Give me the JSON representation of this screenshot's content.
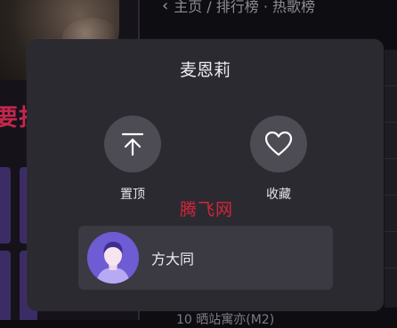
{
  "background": {
    "header_breadcrumb": "主页 / 排行榜 · 热歌榜",
    "left_banner_text": "要担",
    "bottom_list_text": "10  晒站寓亦(M2)"
  },
  "sheet": {
    "title": "麦恩莉",
    "actions": [
      {
        "label": "置顶",
        "icon": "pin-to-top-icon"
      },
      {
        "label": "收藏",
        "icon": "heart-outline-icon"
      }
    ],
    "singer": {
      "name": "方大同",
      "avatar_color": "#6d5cd3"
    }
  },
  "watermark": "腾飞网",
  "colors": {
    "sheet_bg": "#2b2a31",
    "action_circle": "#4d4c54",
    "singer_card_bg": "#3b3a42",
    "watermark": "#d3263a"
  }
}
